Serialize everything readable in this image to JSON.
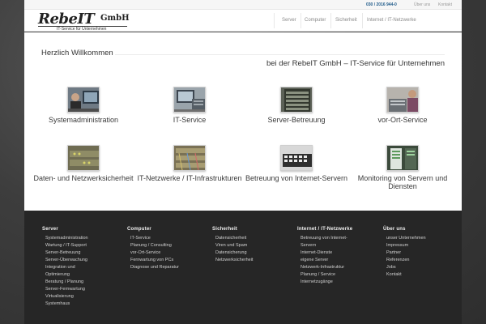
{
  "topbar": {
    "phone": "030 / 2016 944-0",
    "link_about": "Über uns",
    "link_contact": "Kontakt"
  },
  "logo": {
    "main": "RebeIT",
    "suffix": "GmbH",
    "tagline": "IT-Service für Unternehmen"
  },
  "nav": {
    "items": [
      "Server",
      "Computer",
      "Sicherheit",
      "Internet / IT-Netzwerke"
    ]
  },
  "main": {
    "welcome": "Herzlich Willkommen",
    "subtitle": "bei der RebeIT GmbH – IT-Service für Unternehmen",
    "services": [
      {
        "label": "Systemadministration",
        "icon": "person-monitor-photo"
      },
      {
        "label": "IT-Service",
        "icon": "computer-repair-photo"
      },
      {
        "label": "Server-Betreuung",
        "icon": "server-rack-photo"
      },
      {
        "label": "vor-Ort-Service",
        "icon": "technician-photo"
      },
      {
        "label": "Daten- und Netzwerksicherheit",
        "icon": "network-switch-photo"
      },
      {
        "label": "IT-Netzwerke / IT-Infrastrukturen",
        "icon": "cabling-photo"
      },
      {
        "label": "Betreuung von Internet-Servern",
        "icon": "keyboard-photo"
      },
      {
        "label": "Monitoring von Servern und Diensten",
        "icon": "monitoring-photo"
      }
    ]
  },
  "footer": {
    "columns": [
      {
        "heading": "Server",
        "items": [
          "Systemadministration",
          "Wartung / IT-Support",
          "Server-Betreuung",
          "Server-Überwachung",
          "Integration und",
          "Optimierung",
          "Beratung / Planung",
          "Server-Fernwartung",
          "Virtualisierung",
          "Systemhaus"
        ]
      },
      {
        "heading": "Computer",
        "items": [
          "IT-Service",
          "Planung / Consulting",
          "vor-Ort-Service",
          "Fernwartung von PCs",
          "Diagnose und Reparatur"
        ]
      },
      {
        "heading": "Sicherheit",
        "items": [
          "Datensicherheit",
          "Viren und Spam",
          "Datensicherung",
          "Netzwerksicherheit"
        ]
      },
      {
        "heading": "Internet / IT-Netzwerke",
        "items": [
          "Betreuung von Internet-",
          "Servern",
          "Internet-Dienste",
          "eigene Server",
          "Netzwerk-Infrastruktur",
          "Planung / Service",
          "Internetzugänge"
        ]
      },
      {
        "heading": "Über uns",
        "items": [
          "unser Unternehmen",
          "Impressum",
          "Partner",
          "Referenzen",
          "Jobs",
          "Kontakt"
        ]
      }
    ]
  },
  "colors": {
    "accent_phone": "#1e5a8a",
    "footer_bg": "#262626",
    "page_bg": "#ffffff"
  }
}
